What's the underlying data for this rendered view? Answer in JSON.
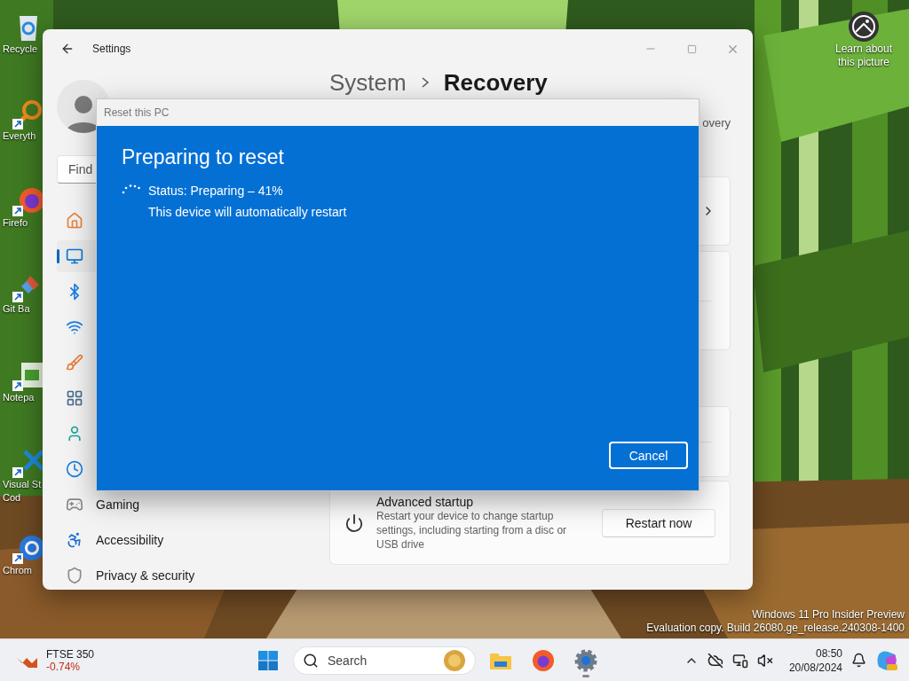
{
  "desktop": {
    "icons": [
      {
        "kind": "recycle",
        "lines": [
          "Recycle"
        ]
      },
      {
        "kind": "finder",
        "lines": [
          "Everyth"
        ]
      },
      {
        "kind": "firefox",
        "lines": [
          "Firefo"
        ]
      },
      {
        "kind": "git",
        "lines": [
          "Git Ba"
        ]
      },
      {
        "kind": "notepad",
        "lines": [
          "Notepa"
        ]
      },
      {
        "kind": "code",
        "lines": [
          "Visual St",
          "Cod"
        ]
      },
      {
        "kind": "chrome",
        "lines": [
          "Chrom"
        ]
      }
    ],
    "spotlight": {
      "lines": [
        "Learn about",
        "this picture"
      ]
    },
    "edition": [
      "Windows 11 Pro Insider Preview",
      "Evaluation copy. Build 26080.ge_release.240308-1400"
    ]
  },
  "settings": {
    "title": "Settings",
    "search": {
      "placeholder": "Find"
    },
    "breadcrumb": [
      "System",
      "Recovery"
    ],
    "link_fragment": "overy",
    "nav": [
      {
        "kind": "home",
        "selected": false
      },
      {
        "kind": "system",
        "selected": true
      },
      {
        "kind": "bluetooth",
        "selected": false
      },
      {
        "kind": "network",
        "selected": false
      },
      {
        "kind": "personalization",
        "selected": false
      },
      {
        "kind": "apps",
        "selected": false
      },
      {
        "kind": "accounts",
        "selected": false
      },
      {
        "kind": "time",
        "selected": false
      },
      {
        "kind": "gaming",
        "label": "Gaming",
        "selected": false
      },
      {
        "kind": "accessibility",
        "label": "Accessibility",
        "selected": false
      },
      {
        "kind": "privacy",
        "label": "Privacy & security",
        "selected": false
      }
    ],
    "cards": [
      {
        "kind": "link"
      },
      {
        "kind": "group"
      },
      {
        "kind": "group"
      },
      {
        "kind": "action",
        "title": "Advanced startup",
        "description": "Restart your device to change startup settings, including starting from a disc or USB drive",
        "button": "Restart now"
      }
    ]
  },
  "dialog": {
    "title": "Reset this PC",
    "heading": "Preparing to reset",
    "status": "Status: Preparing – 41%",
    "note": "This device will automatically restart",
    "button": "Cancel"
  },
  "taskbar": {
    "widget": {
      "name": "FTSE 350",
      "change": "-0.74%"
    },
    "search": {
      "placeholder": "Search"
    },
    "apps": [
      {
        "kind": "folder",
        "selected": false
      },
      {
        "kind": "firefox",
        "selected": false
      },
      {
        "kind": "settings",
        "selected": true
      }
    ],
    "clock": {
      "time": "08:50",
      "date": "20/08/2024"
    }
  }
}
